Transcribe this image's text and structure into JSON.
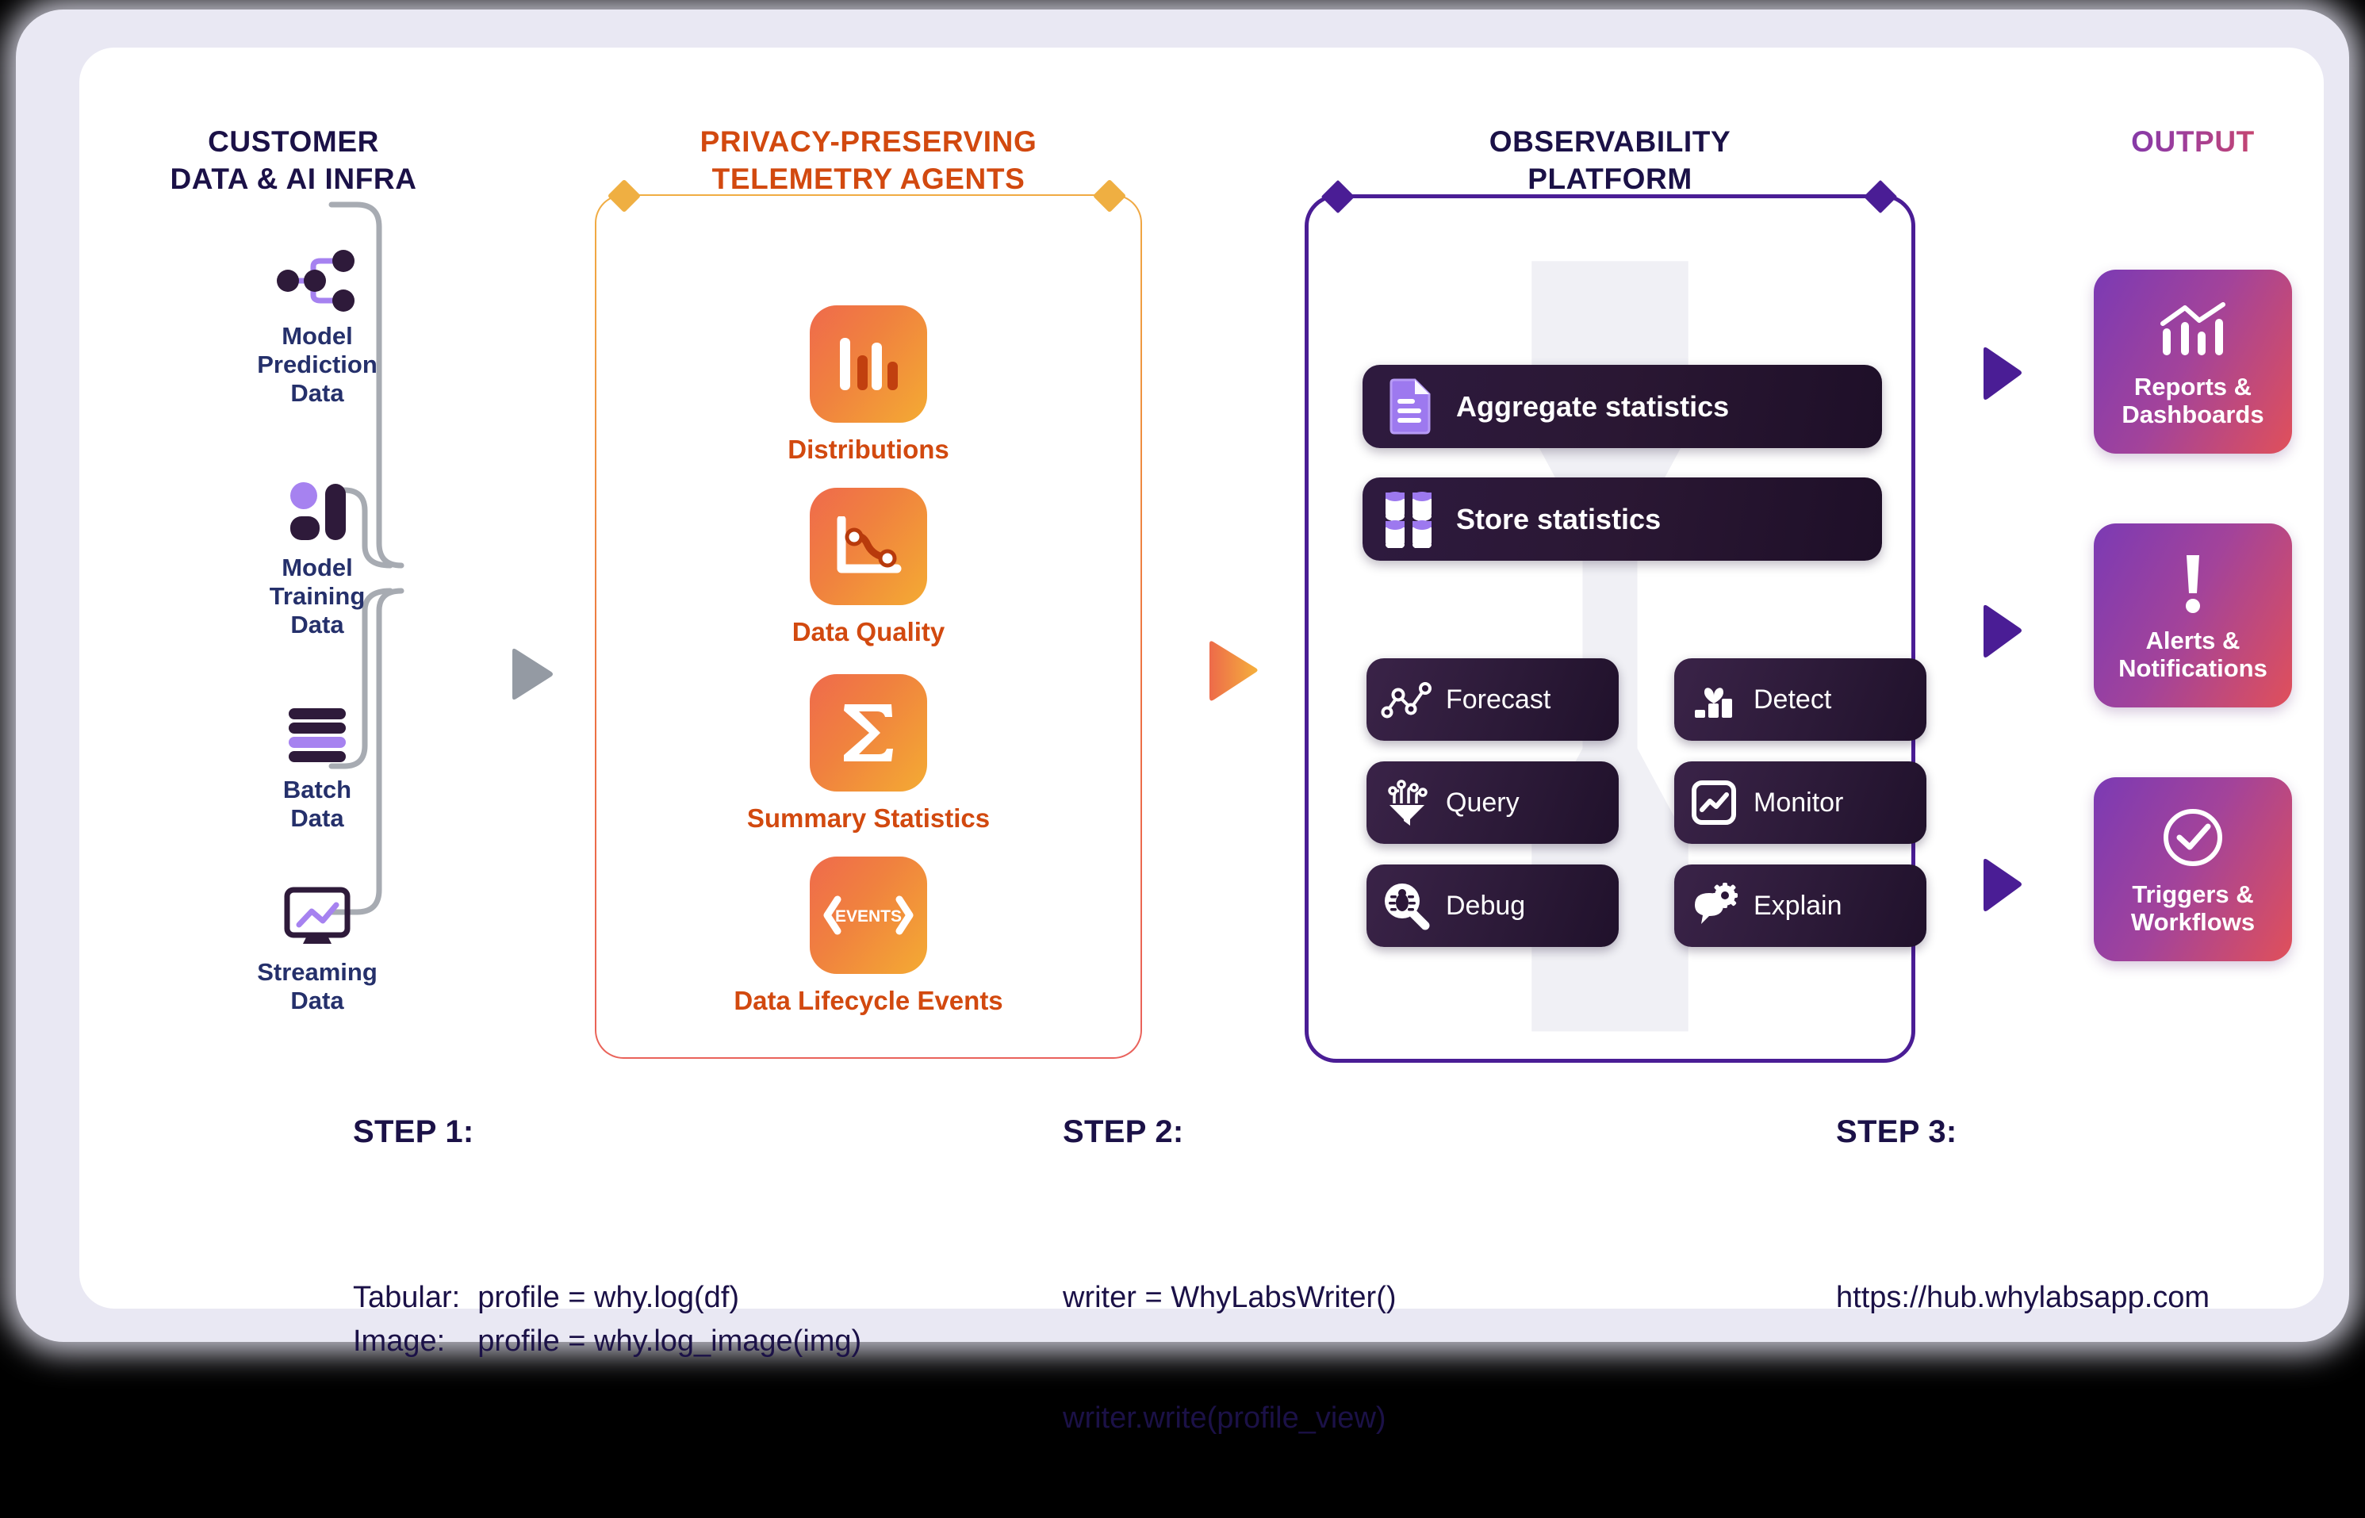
{
  "columns": {
    "customer": {
      "title_line1": "CUSTOMER",
      "title_line2": "DATA & AI INFRA"
    },
    "telemetry": {
      "title_line1": "PRIVACY-PRESERVING",
      "title_line2": "TELEMETRY AGENTS"
    },
    "observability": {
      "title_line1": "OBSERVABILITY",
      "title_line2": "PLATFORM"
    },
    "output": {
      "title": "OUTPUT"
    }
  },
  "sources": [
    {
      "label_line1": "Model",
      "label_line2": "Prediction",
      "label_line3": "Data",
      "icon": "network-nodes-icon"
    },
    {
      "label_line1": "Model",
      "label_line2": "Training",
      "label_line3": "Data",
      "icon": "bar-chart-blocks-icon"
    },
    {
      "label_line1": "Batch",
      "label_line2": "Data",
      "label_line3": "",
      "icon": "database-stack-icon"
    },
    {
      "label_line1": "Streaming",
      "label_line2": "Data",
      "label_line3": "",
      "icon": "monitor-stream-icon"
    }
  ],
  "telemetry_agents": [
    {
      "label": "Distributions",
      "icon": "histogram-bars-icon"
    },
    {
      "label": "Data Quality",
      "icon": "line-chart-axes-icon"
    },
    {
      "label": "Summary Statistics",
      "icon": "sigma-icon"
    },
    {
      "label": "Data Lifecycle Events",
      "icon": "events-chevrons-icon",
      "icon_text": "EVENTS"
    }
  ],
  "platform_rows": [
    {
      "label": "Aggregate statistics",
      "icon": "document-lines-icon"
    },
    {
      "label": "Store statistics",
      "icon": "database-cylinders-icon"
    }
  ],
  "platform_capabilities": [
    {
      "label": "Forecast",
      "icon": "trend-nodes-icon"
    },
    {
      "label": "Detect",
      "icon": "heartbeat-bars-icon"
    },
    {
      "label": "Query",
      "icon": "funnel-circuit-icon"
    },
    {
      "label": "Monitor",
      "icon": "chart-frame-icon"
    },
    {
      "label": "Debug",
      "icon": "bug-magnifier-icon"
    },
    {
      "label": "Explain",
      "icon": "chat-gear-icon"
    }
  ],
  "outputs": [
    {
      "label_line1": "Reports &",
      "label_line2": "Dashboards",
      "icon": "bar-line-chart-icon"
    },
    {
      "label_line1": "Alerts &",
      "label_line2": "Notifications",
      "icon": "exclamation-icon"
    },
    {
      "label_line1": "Triggers &",
      "label_line2": "Workflows",
      "icon": "check-circle-icon"
    }
  ],
  "steps": [
    {
      "title": "STEP 1:",
      "rows": [
        {
          "key": "Tabular:",
          "code": "profile = why.log(df)"
        },
        {
          "key": "Image:",
          "code": "profile = why.log_image(img)"
        }
      ]
    },
    {
      "title": "STEP 2:",
      "lines": [
        "writer = WhyLabsWriter()",
        "writer.write(profile_view)"
      ]
    },
    {
      "title": "STEP 3:",
      "lines": [
        "https://hub.whylabsapp.com"
      ]
    }
  ],
  "colors": {
    "navy": "#1b1147",
    "source_label": "#25306b",
    "orange_text": "#d2490f",
    "telemetry_border_top": "#f0ae44",
    "telemetry_border_bottom": "#e9615c",
    "platform_border": "#4a1d95",
    "output_gradient_start": "#7b3ab4",
    "output_gradient_end": "#e0505a",
    "arrow_gray": "#949aa3",
    "arrow_orange": "#ee7a3c",
    "arrow_purple": "#4a1d95",
    "connector_gray": "#a7abb2",
    "frame": "#e9e8f3",
    "accent_lavender": "#a682f0",
    "icon_dark": "#2e1a3a"
  }
}
